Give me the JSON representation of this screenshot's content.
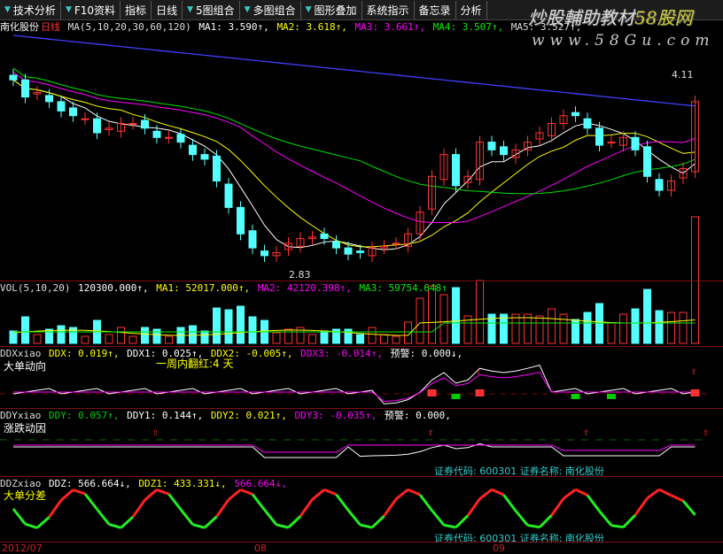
{
  "toolbar": {
    "items": [
      "技术分析",
      "F10资料",
      "指标",
      "日线",
      "5图组合",
      "多图组合",
      "图形叠加",
      "系统指示",
      "备忘录",
      "分析"
    ]
  },
  "watermark": {
    "line1": "炒股輔助教材",
    "line1_accent": "58股网",
    "line2": "www.58Gu.com"
  },
  "price_header": {
    "stock": "南化股份",
    "period": "日线",
    "ma_def": "MA(5,10,20,30,60,120)",
    "ma1": "MA1: 3.590↑,",
    "ma2": "MA2: 3.618↑,",
    "ma3": "MA3: 3.661↑,",
    "ma4": "MA4: 3.507↑,",
    "ma5": "MA5: 3.527↑,"
  },
  "price_labels": {
    "high": "4.11",
    "low": "2.83"
  },
  "vol_header": {
    "name": "VOL(5,10,20)",
    "value": "120300.000↑,",
    "ma1": "MA1: 52017.000↑,",
    "ma2": "MA2: 42120.398↑,",
    "ma3": "MA3: 59754.648↑"
  },
  "ddx_header": {
    "name": "DDXxiao",
    "ddx": "DDX: 0.019↑,",
    "ddx1": "DDX1: 0.025↑,",
    "ddx2": "DDX2: -0.005↑,",
    "ddx3": "DDX3: -0.014↑,",
    "warn": "预警: 0.000↓,",
    "title": "大单动向",
    "note": "一周内翻红:4 天"
  },
  "ddy_header": {
    "name": "DDYxiao",
    "ddy": "DDY: 0.057↑,",
    "ddy1": "DDY1: 0.144↑,",
    "ddy2": "DDY2: 0.021↑,",
    "ddy3": "DDY3: -0.035↑,",
    "warn": "预警: 0.000,",
    "title": "涨跌动因",
    "code_info": "证券代码: 600301  证券名称: 南化股份"
  },
  "ddz_header": {
    "name": "DDZxiao",
    "ddz": "DDZ: 566.664↓,",
    "ddz1": "DDZ1: 433.331↓,",
    "ddz2": "566.664↓,",
    "title": "大单分差",
    "code_info": "证券代码: 600301  证券名称: 南化股份"
  },
  "date_axis": {
    "start": "2012/07",
    "m2": "08",
    "m3": "09"
  },
  "colors": {
    "up": "#ff3232",
    "down": "#54ffff",
    "ma1": "#ffffff",
    "ma2": "#ffff00",
    "ma3": "#ff00ff",
    "ma4": "#00e000",
    "ma5": "#4040ff"
  },
  "chart_data": {
    "type": "candlestick",
    "closes": [
      4.08,
      3.97,
      4.0,
      3.94,
      3.88,
      3.85,
      3.83,
      3.74,
      3.77,
      3.8,
      3.8,
      3.77,
      3.71,
      3.71,
      3.68,
      3.6,
      3.57,
      3.43,
      3.26,
      3.09,
      3.0,
      2.95,
      2.97,
      3.03,
      3.06,
      3.07,
      3.06,
      3.0,
      2.96,
      2.97,
      3.0,
      3.01,
      3.03,
      3.09,
      3.23,
      3.46,
      3.6,
      3.4,
      3.46,
      3.68,
      3.63,
      3.6,
      3.63,
      3.68,
      3.74,
      3.8,
      3.85,
      3.85,
      3.77,
      3.66,
      3.68,
      3.71,
      3.63,
      3.46,
      3.37,
      3.43,
      3.51,
      3.94
    ],
    "ylim": [
      2.83,
      4.11
    ]
  }
}
